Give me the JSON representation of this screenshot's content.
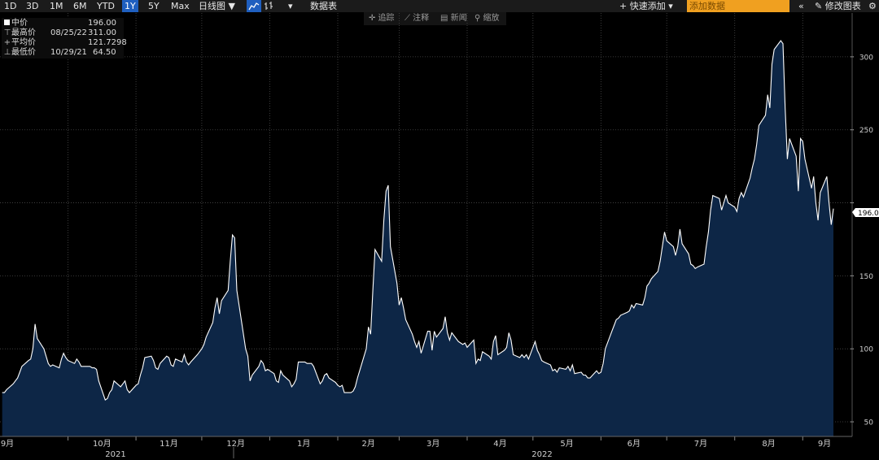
{
  "toolbar": {
    "ranges": [
      "1D",
      "3D",
      "1M",
      "6M",
      "YTD",
      "1Y",
      "5Y",
      "Max"
    ],
    "active_range": "1Y",
    "chart_type": "日线图 ▼",
    "line_icon": "line-chart-icon",
    "bar_icon": "ohlc-bar-icon",
    "dropdown_arrow": "▾",
    "table_label": "数据表",
    "quick_add": "+ 快速添加 ▾",
    "add_data_placeholder": "添加数据",
    "collapse": "«",
    "edit_chart": "✎ 修改图表",
    "settings_icon": "gear-icon"
  },
  "float_toolbar": {
    "track": "✛ 追踪",
    "annotate": "⟋ 注释",
    "news": "▤ 新闻",
    "zoom": "⚲ 缩放"
  },
  "legend": {
    "series_name": "中价",
    "series_value": "196.00",
    "high_label": "最高价",
    "high_date": "08/25/22",
    "high_value": "311.00",
    "avg_label": "平均价",
    "avg_value": "121.7298",
    "low_label": "最低价",
    "low_date": "10/29/21",
    "low_value": "64.50"
  },
  "colors": {
    "line": "#ffffff",
    "area": "#0d2646",
    "grid": "#4a4a4a",
    "background": "#000000",
    "active": "#1f5fbf",
    "input": "#f0a020"
  },
  "chart_data": {
    "type": "area",
    "series": [
      {
        "name": "中价"
      }
    ],
    "ylim": [
      40,
      330
    ],
    "y_ticks": [
      50,
      100,
      150,
      200,
      250,
      300
    ],
    "y_tick_labels": [
      "50",
      "100",
      "150",
      "",
      "250",
      "300"
    ],
    "x_months": [
      "9月",
      "10月",
      "11月",
      "12月",
      "1月",
      "2月",
      "3月",
      "4月",
      "5月",
      "6月",
      "7月",
      "8月",
      "9月"
    ],
    "years": [
      "2021",
      "2022"
    ],
    "last_value_label": "196.00",
    "grid": true,
    "points": [
      [
        "2021-09-01",
        70
      ],
      [
        "2021-09-02",
        70
      ],
      [
        "2021-09-03",
        72
      ],
      [
        "2021-09-06",
        76
      ],
      [
        "2021-09-07",
        78
      ],
      [
        "2021-09-08",
        80
      ],
      [
        "2021-09-09",
        84
      ],
      [
        "2021-09-10",
        88
      ],
      [
        "2021-09-13",
        92
      ],
      [
        "2021-09-14",
        93
      ],
      [
        "2021-09-15",
        100
      ],
      [
        "2021-09-16",
        117
      ],
      [
        "2021-09-17",
        107
      ],
      [
        "2021-09-20",
        100
      ],
      [
        "2021-09-21",
        95
      ],
      [
        "2021-09-22",
        90
      ],
      [
        "2021-09-23",
        88
      ],
      [
        "2021-09-24",
        89
      ],
      [
        "2021-09-27",
        87
      ],
      [
        "2021-09-28",
        93
      ],
      [
        "2021-09-29",
        97
      ],
      [
        "2021-09-30",
        94
      ],
      [
        "2021-10-01",
        92
      ],
      [
        "2021-10-04",
        90
      ],
      [
        "2021-10-05",
        93
      ],
      [
        "2021-10-06",
        91
      ],
      [
        "2021-10-07",
        88
      ],
      [
        "2021-10-08",
        88
      ],
      [
        "2021-10-11",
        88
      ],
      [
        "2021-10-12",
        87
      ],
      [
        "2021-10-13",
        87
      ],
      [
        "2021-10-14",
        86
      ],
      [
        "2021-10-15",
        78
      ],
      [
        "2021-10-18",
        65
      ],
      [
        "2021-10-19",
        66
      ],
      [
        "2021-10-20",
        70
      ],
      [
        "2021-10-21",
        72
      ],
      [
        "2021-10-22",
        78
      ],
      [
        "2021-10-25",
        74
      ],
      [
        "2021-10-26",
        76
      ],
      [
        "2021-10-27",
        78
      ],
      [
        "2021-10-28",
        72
      ],
      [
        "2021-10-29",
        70
      ],
      [
        "2021-11-01",
        75
      ],
      [
        "2021-11-02",
        76
      ],
      [
        "2021-11-03",
        82
      ],
      [
        "2021-11-04",
        87
      ],
      [
        "2021-11-05",
        94
      ],
      [
        "2021-11-08",
        95
      ],
      [
        "2021-11-09",
        92
      ],
      [
        "2021-11-10",
        87
      ],
      [
        "2021-11-11",
        86
      ],
      [
        "2021-11-12",
        90
      ],
      [
        "2021-11-15",
        95
      ],
      [
        "2021-11-16",
        94
      ],
      [
        "2021-11-17",
        89
      ],
      [
        "2021-11-18",
        88
      ],
      [
        "2021-11-19",
        93
      ],
      [
        "2021-11-22",
        91
      ],
      [
        "2021-11-23",
        96
      ],
      [
        "2021-11-24",
        91
      ],
      [
        "2021-11-25",
        89
      ],
      [
        "2021-11-26",
        91
      ],
      [
        "2021-11-29",
        96
      ],
      [
        "2021-11-30",
        98
      ],
      [
        "2021-12-01",
        100
      ],
      [
        "2021-12-02",
        103
      ],
      [
        "2021-12-03",
        108
      ],
      [
        "2021-12-06",
        118
      ],
      [
        "2021-12-07",
        128
      ],
      [
        "2021-12-08",
        135
      ],
      [
        "2021-12-09",
        124
      ],
      [
        "2021-12-10",
        133
      ],
      [
        "2021-12-13",
        140
      ],
      [
        "2021-12-14",
        160
      ],
      [
        "2021-12-15",
        178
      ],
      [
        "2021-12-16",
        176
      ],
      [
        "2021-12-17",
        140
      ],
      [
        "2021-12-20",
        110
      ],
      [
        "2021-12-21",
        100
      ],
      [
        "2021-12-22",
        95
      ],
      [
        "2021-12-23",
        78
      ],
      [
        "2021-12-24",
        82
      ],
      [
        "2021-12-27",
        88
      ],
      [
        "2021-12-28",
        92
      ],
      [
        "2021-12-29",
        90
      ],
      [
        "2021-12-30",
        85
      ],
      [
        "2021-12-31",
        86
      ],
      [
        "2022-01-03",
        83
      ],
      [
        "2022-01-04",
        78
      ],
      [
        "2022-01-05",
        77
      ],
      [
        "2022-01-06",
        85
      ],
      [
        "2022-01-07",
        82
      ],
      [
        "2022-01-10",
        78
      ],
      [
        "2022-01-11",
        74
      ],
      [
        "2022-01-12",
        76
      ],
      [
        "2022-01-13",
        79
      ],
      [
        "2022-01-14",
        91
      ],
      [
        "2022-01-17",
        91
      ],
      [
        "2022-01-18",
        90
      ],
      [
        "2022-01-19",
        90
      ],
      [
        "2022-01-20",
        90
      ],
      [
        "2022-01-21",
        88
      ],
      [
        "2022-01-24",
        76
      ],
      [
        "2022-01-25",
        78
      ],
      [
        "2022-01-26",
        82
      ],
      [
        "2022-01-27",
        83
      ],
      [
        "2022-01-28",
        80
      ],
      [
        "2022-01-31",
        77
      ],
      [
        "2022-02-01",
        75
      ],
      [
        "2022-02-02",
        74
      ],
      [
        "2022-02-03",
        75
      ],
      [
        "2022-02-04",
        70
      ],
      [
        "2022-02-07",
        70
      ],
      [
        "2022-02-08",
        71
      ],
      [
        "2022-02-09",
        74
      ],
      [
        "2022-02-10",
        80
      ],
      [
        "2022-02-11",
        85
      ],
      [
        "2022-02-14",
        100
      ],
      [
        "2022-02-15",
        115
      ],
      [
        "2022-02-16",
        110
      ],
      [
        "2022-02-17",
        140
      ],
      [
        "2022-02-18",
        168
      ],
      [
        "2022-02-21",
        160
      ],
      [
        "2022-02-22",
        188
      ],
      [
        "2022-02-23",
        208
      ],
      [
        "2022-02-24",
        212
      ],
      [
        "2022-02-25",
        170
      ],
      [
        "2022-02-28",
        145
      ],
      [
        "2022-03-01",
        130
      ],
      [
        "2022-03-02",
        135
      ],
      [
        "2022-03-03",
        128
      ],
      [
        "2022-03-04",
        120
      ],
      [
        "2022-03-07",
        110
      ],
      [
        "2022-03-08",
        105
      ],
      [
        "2022-03-09",
        101
      ],
      [
        "2022-03-10",
        105
      ],
      [
        "2022-03-11",
        97
      ],
      [
        "2022-03-14",
        112
      ],
      [
        "2022-03-15",
        112
      ],
      [
        "2022-03-16",
        99
      ],
      [
        "2022-03-17",
        112
      ],
      [
        "2022-03-18",
        108
      ],
      [
        "2022-03-21",
        114
      ],
      [
        "2022-03-22",
        122
      ],
      [
        "2022-03-23",
        111
      ],
      [
        "2022-03-24",
        106
      ],
      [
        "2022-03-25",
        111
      ],
      [
        "2022-03-28",
        105
      ],
      [
        "2022-03-29",
        104
      ],
      [
        "2022-03-30",
        103
      ],
      [
        "2022-03-31",
        104
      ],
      [
        "2022-04-01",
        101
      ],
      [
        "2022-04-04",
        106
      ],
      [
        "2022-04-05",
        90
      ],
      [
        "2022-04-06",
        93
      ],
      [
        "2022-04-07",
        92
      ],
      [
        "2022-04-08",
        98
      ],
      [
        "2022-04-11",
        95
      ],
      [
        "2022-04-12",
        93
      ],
      [
        "2022-04-13",
        105
      ],
      [
        "2022-04-14",
        109
      ],
      [
        "2022-04-15",
        96
      ],
      [
        "2022-04-18",
        99
      ],
      [
        "2022-04-19",
        101
      ],
      [
        "2022-04-20",
        111
      ],
      [
        "2022-04-21",
        106
      ],
      [
        "2022-04-22",
        96
      ],
      [
        "2022-04-25",
        94
      ],
      [
        "2022-04-26",
        96
      ],
      [
        "2022-04-27",
        94
      ],
      [
        "2022-04-28",
        96
      ],
      [
        "2022-04-29",
        93
      ],
      [
        "2022-05-02",
        105
      ],
      [
        "2022-05-03",
        99
      ],
      [
        "2022-05-04",
        96
      ],
      [
        "2022-05-05",
        92
      ],
      [
        "2022-05-06",
        91
      ],
      [
        "2022-05-09",
        89
      ],
      [
        "2022-05-10",
        85
      ],
      [
        "2022-05-11",
        86
      ],
      [
        "2022-05-12",
        84
      ],
      [
        "2022-05-13",
        87
      ],
      [
        "2022-05-16",
        86
      ],
      [
        "2022-05-17",
        88
      ],
      [
        "2022-05-18",
        85
      ],
      [
        "2022-05-19",
        89
      ],
      [
        "2022-05-20",
        83
      ],
      [
        "2022-05-23",
        84
      ],
      [
        "2022-05-24",
        82
      ],
      [
        "2022-05-25",
        82
      ],
      [
        "2022-05-26",
        80
      ],
      [
        "2022-05-27",
        80
      ],
      [
        "2022-05-30",
        85
      ],
      [
        "2022-05-31",
        83
      ],
      [
        "2022-06-01",
        84
      ],
      [
        "2022-06-02",
        90
      ],
      [
        "2022-06-03",
        100
      ],
      [
        "2022-06-06",
        112
      ],
      [
        "2022-06-07",
        116
      ],
      [
        "2022-06-08",
        120
      ],
      [
        "2022-06-09",
        121
      ],
      [
        "2022-06-10",
        123
      ],
      [
        "2022-06-13",
        125
      ],
      [
        "2022-06-14",
        126
      ],
      [
        "2022-06-15",
        130
      ],
      [
        "2022-06-16",
        128
      ],
      [
        "2022-06-17",
        131
      ],
      [
        "2022-06-20",
        130
      ],
      [
        "2022-06-21",
        135
      ],
      [
        "2022-06-22",
        143
      ],
      [
        "2022-06-23",
        145
      ],
      [
        "2022-06-24",
        148
      ],
      [
        "2022-06-27",
        153
      ],
      [
        "2022-06-28",
        160
      ],
      [
        "2022-06-29",
        170
      ],
      [
        "2022-06-30",
        180
      ],
      [
        "2022-07-01",
        174
      ],
      [
        "2022-07-04",
        170
      ],
      [
        "2022-07-05",
        164
      ],
      [
        "2022-07-06",
        170
      ],
      [
        "2022-07-07",
        182
      ],
      [
        "2022-07-08",
        172
      ],
      [
        "2022-07-11",
        165
      ],
      [
        "2022-07-12",
        158
      ],
      [
        "2022-07-13",
        157
      ],
      [
        "2022-07-14",
        155
      ],
      [
        "2022-07-15",
        156
      ],
      [
        "2022-07-18",
        158
      ],
      [
        "2022-07-19",
        170
      ],
      [
        "2022-07-20",
        180
      ],
      [
        "2022-07-21",
        195
      ],
      [
        "2022-07-22",
        205
      ],
      [
        "2022-07-25",
        203
      ],
      [
        "2022-07-26",
        195
      ],
      [
        "2022-07-27",
        200
      ],
      [
        "2022-07-28",
        205
      ],
      [
        "2022-07-29",
        200
      ],
      [
        "2022-08-01",
        197
      ],
      [
        "2022-08-02",
        194
      ],
      [
        "2022-08-03",
        203
      ],
      [
        "2022-08-04",
        207
      ],
      [
        "2022-08-05",
        204
      ],
      [
        "2022-08-08",
        217
      ],
      [
        "2022-08-09",
        224
      ],
      [
        "2022-08-10",
        230
      ],
      [
        "2022-08-11",
        240
      ],
      [
        "2022-08-12",
        253
      ],
      [
        "2022-08-15",
        260
      ],
      [
        "2022-08-16",
        274
      ],
      [
        "2022-08-17",
        265
      ],
      [
        "2022-08-18",
        295
      ],
      [
        "2022-08-19",
        305
      ],
      [
        "2022-08-22",
        311
      ],
      [
        "2022-08-23",
        309
      ],
      [
        "2022-08-24",
        265
      ],
      [
        "2022-08-25",
        230
      ],
      [
        "2022-08-26",
        244
      ],
      [
        "2022-08-29",
        232
      ],
      [
        "2022-08-30",
        208
      ],
      [
        "2022-08-31",
        244
      ],
      [
        "2022-09-01",
        242
      ],
      [
        "2022-09-02",
        230
      ],
      [
        "2022-09-05",
        210
      ],
      [
        "2022-09-06",
        218
      ],
      [
        "2022-09-07",
        200
      ],
      [
        "2022-09-08",
        188
      ],
      [
        "2022-09-09",
        207
      ],
      [
        "2022-09-12",
        218
      ],
      [
        "2022-09-13",
        200
      ],
      [
        "2022-09-14",
        185
      ],
      [
        "2022-09-15",
        196
      ]
    ]
  }
}
